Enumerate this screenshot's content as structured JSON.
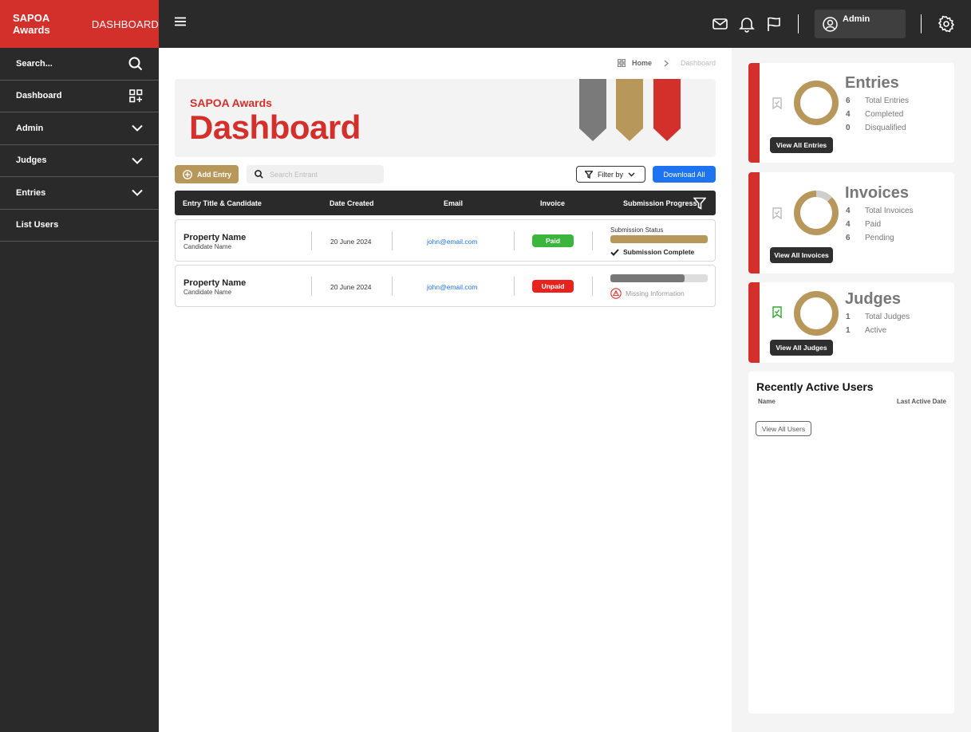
{
  "brand": {
    "bold": "SAPOA Awards",
    "light": "DASHBOARD"
  },
  "sidebar": {
    "search_label": "Search...",
    "items": [
      {
        "label": "Dashboard"
      },
      {
        "label": "Admin"
      },
      {
        "label": "Judges"
      },
      {
        "label": "Entries"
      },
      {
        "label": "List Users"
      }
    ]
  },
  "topbar": {
    "user_name": "Admin"
  },
  "breadcrumb": {
    "home": "Home",
    "current": "Dashboard"
  },
  "hero": {
    "subtitle": "SAPOA Awards",
    "title": "Dashboard"
  },
  "toolbar": {
    "add_entry": "Add Entry",
    "search_placeholder": "Search Entrant",
    "filter_by": "Filter by",
    "download_all": "Download All"
  },
  "table": {
    "headers": [
      "Entry Title  & Candidate",
      "Date Created",
      "Email",
      "Invoice",
      "Submission Progress"
    ],
    "rows": [
      {
        "property": "Property Name",
        "candidate": "Candidate Name",
        "date": "20 June 2024",
        "email": "john@email.com",
        "invoice": "Paid",
        "status_label": "Submission Status",
        "progress": 1.0,
        "status_text": "Submission Complete"
      },
      {
        "property": "Property Name",
        "candidate": "Candidate Name",
        "date": "20 June 2024",
        "email": "john@email.com",
        "invoice": "Unpaid",
        "progress": 0.76,
        "status_text": "Missing Information"
      }
    ]
  },
  "cards": {
    "entries": {
      "title": "Entries",
      "lines": [
        {
          "value": "6",
          "label": "Total Entries"
        },
        {
          "value": "4",
          "label": "Completed"
        },
        {
          "value": "0",
          "label": "Disqualified"
        }
      ],
      "button": "View All Entries"
    },
    "invoices": {
      "title": "Invoices",
      "lines": [
        {
          "value": "4",
          "label": "Total Invoices"
        },
        {
          "value": "4",
          "label": "Paid"
        },
        {
          "value": "6",
          "label": "Pending"
        }
      ],
      "button": "View All Invoices"
    },
    "judges": {
      "title": "Judges",
      "lines": [
        {
          "value": "1",
          "label": "Total Judges"
        },
        {
          "value": "1",
          "label": "Active"
        }
      ],
      "button": "View All Judges"
    }
  },
  "recent_users": {
    "title": "Recently Active Users",
    "col_name": "Name",
    "col_date": "Last Active Date",
    "button": "View All Users"
  },
  "colors": {
    "brand_red": "#d32f2b",
    "gold": "#b8975b",
    "dark": "#2a2a2a",
    "blue": "#1e74f0",
    "paid_green": "#3cb53c",
    "unpaid_red": "#e8221c"
  }
}
